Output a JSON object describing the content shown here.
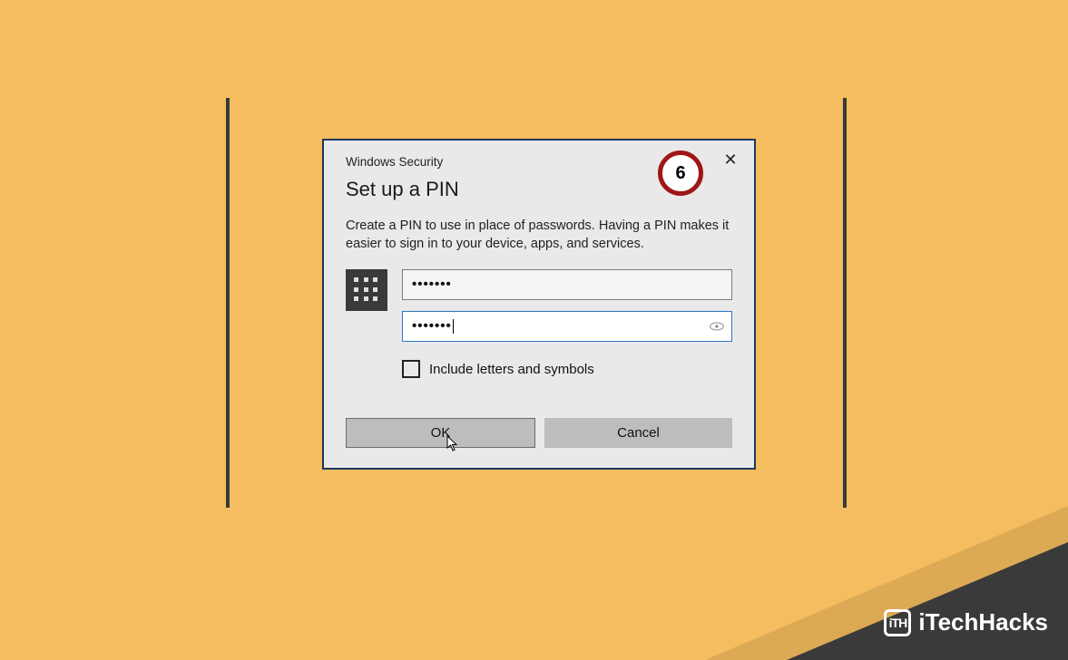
{
  "dialog": {
    "header_text": "Windows Security",
    "close_glyph": "✕",
    "title": "Set up a PIN",
    "description": "Create a PIN to use in place of passwords. Having a PIN makes it easier to sign in to your device, apps, and services.",
    "pin_value_masked": "•••••••",
    "confirm_value_masked": "•••••••",
    "include_label": "Include letters and symbols",
    "ok_label": "OK",
    "cancel_label": "Cancel"
  },
  "annotation": {
    "step_number": "6"
  },
  "branding": {
    "logo_text": "iTH",
    "site_name": "iTechHacks"
  }
}
